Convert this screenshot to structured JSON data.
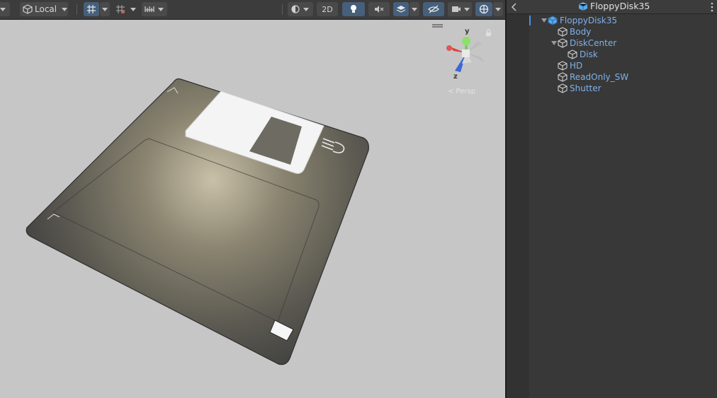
{
  "toolbar": {
    "pivot_rotation_label": "Local",
    "mode_2d_label": "2D"
  },
  "gizmo": {
    "y_label": "y",
    "z_label": "z",
    "view_label": "< Persp"
  },
  "hierarchy": {
    "title": "FloppyDisk35",
    "items": [
      {
        "label": "FloppyDisk35",
        "depth": 0,
        "expanded": true,
        "is_prefab": true
      },
      {
        "label": "Body",
        "depth": 1
      },
      {
        "label": "DiskCenter",
        "depth": 1,
        "expanded": true
      },
      {
        "label": "Disk",
        "depth": 2
      },
      {
        "label": "HD",
        "depth": 1
      },
      {
        "label": "ReadOnly_SW",
        "depth": 1
      },
      {
        "label": "Shutter",
        "depth": 1
      }
    ]
  },
  "colors": {
    "toolbar_bg": "#3c3c3c",
    "active_toggle": "#46607c",
    "hierarchy_text": "#7fb1ea",
    "scene_bg": "#c6c6c6"
  }
}
